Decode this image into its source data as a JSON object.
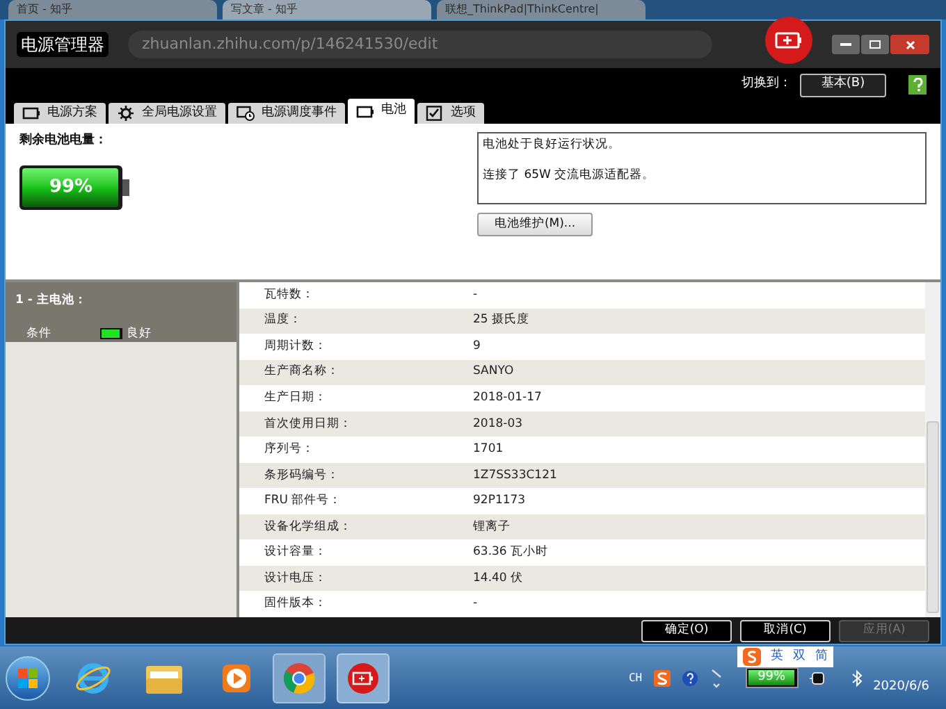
{
  "browser": {
    "tabs": [
      {
        "title": "首页 - 知乎",
        "selected": false
      },
      {
        "title": "写文章 - 知乎",
        "selected": true
      },
      {
        "title": "联想_ThinkPad|ThinkCentre|",
        "selected": false
      }
    ],
    "address": "zhuanlan.zhihu.com/p/146241530/edit"
  },
  "window": {
    "title": "电源管理器",
    "switch_label": "切换到：",
    "switch_button": "基本(B)"
  },
  "tabs": [
    {
      "label": "电源方案",
      "kind": "battery",
      "selected": false
    },
    {
      "label": "全局电源设置",
      "kind": "gear",
      "selected": false
    },
    {
      "label": "电源调度事件",
      "kind": "clock",
      "selected": false
    },
    {
      "label": "电池",
      "kind": "battery",
      "selected": true
    },
    {
      "label": "选项",
      "kind": "check",
      "selected": false
    }
  ],
  "charge": {
    "label": "剩余电池电量：",
    "reading": "99%",
    "level": 0.99
  },
  "status": {
    "lines": [
      "电池处于良好运行状况。",
      "连接了 65W 交流电源适配器。"
    ],
    "button": "电池维护(M)..."
  },
  "sidebar": {
    "title": "1 - 主电池：",
    "condition_label": "条件",
    "condition": "良好",
    "level": 0.9
  },
  "details": [
    {
      "label": "瓦特数：",
      "value": "-"
    },
    {
      "label": "温度：",
      "value": "25 摄氏度"
    },
    {
      "label": "周期计数：",
      "value": "9"
    },
    {
      "label": "生产商名称：",
      "value": "SANYO"
    },
    {
      "label": "生产日期：",
      "value": "2018-01-17"
    },
    {
      "label": "首次使用日期：",
      "value": "2018-03"
    },
    {
      "label": "序列号：",
      "value": "1701"
    },
    {
      "label": "条形码编号：",
      "value": "1Z7SS33C121"
    },
    {
      "label": "FRU 部件号：",
      "value": "92P1173"
    },
    {
      "label": "设备化学组成：",
      "value": "锂离子"
    },
    {
      "label": "设计容量：",
      "value": "63.36 瓦小时"
    },
    {
      "label": "设计电压：",
      "value": "14.40 伏"
    },
    {
      "label": "固件版本：",
      "value": "-"
    }
  ],
  "buttons": [
    {
      "label": "确定(O)",
      "disabled": false
    },
    {
      "label": "取消(C)",
      "disabled": false
    },
    {
      "label": "应用(A)",
      "disabled": true
    }
  ],
  "ime": {
    "items": [
      "英",
      "双",
      "简"
    ]
  },
  "taskbar": {
    "tray_text": "CH",
    "battery": "99%",
    "date": "2020/6/6"
  }
}
